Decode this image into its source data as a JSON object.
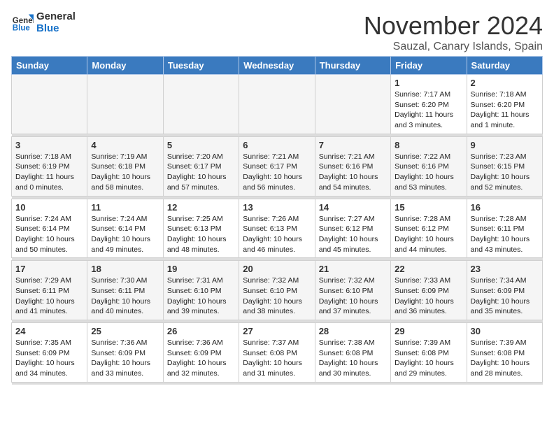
{
  "header": {
    "logo_line1": "General",
    "logo_line2": "Blue",
    "month": "November 2024",
    "location": "Sauzal, Canary Islands, Spain"
  },
  "days_of_week": [
    "Sunday",
    "Monday",
    "Tuesday",
    "Wednesday",
    "Thursday",
    "Friday",
    "Saturday"
  ],
  "weeks": [
    [
      {
        "day": "",
        "empty": true
      },
      {
        "day": "",
        "empty": true
      },
      {
        "day": "",
        "empty": true
      },
      {
        "day": "",
        "empty": true
      },
      {
        "day": "",
        "empty": true
      },
      {
        "day": "1",
        "info": "Sunrise: 7:17 AM\nSunset: 6:20 PM\nDaylight: 11 hours and 3 minutes."
      },
      {
        "day": "2",
        "info": "Sunrise: 7:18 AM\nSunset: 6:20 PM\nDaylight: 11 hours and 1 minute."
      }
    ],
    [
      {
        "day": "3",
        "info": "Sunrise: 7:18 AM\nSunset: 6:19 PM\nDaylight: 11 hours and 0 minutes."
      },
      {
        "day": "4",
        "info": "Sunrise: 7:19 AM\nSunset: 6:18 PM\nDaylight: 10 hours and 58 minutes."
      },
      {
        "day": "5",
        "info": "Sunrise: 7:20 AM\nSunset: 6:17 PM\nDaylight: 10 hours and 57 minutes."
      },
      {
        "day": "6",
        "info": "Sunrise: 7:21 AM\nSunset: 6:17 PM\nDaylight: 10 hours and 56 minutes."
      },
      {
        "day": "7",
        "info": "Sunrise: 7:21 AM\nSunset: 6:16 PM\nDaylight: 10 hours and 54 minutes."
      },
      {
        "day": "8",
        "info": "Sunrise: 7:22 AM\nSunset: 6:16 PM\nDaylight: 10 hours and 53 minutes."
      },
      {
        "day": "9",
        "info": "Sunrise: 7:23 AM\nSunset: 6:15 PM\nDaylight: 10 hours and 52 minutes."
      }
    ],
    [
      {
        "day": "10",
        "info": "Sunrise: 7:24 AM\nSunset: 6:14 PM\nDaylight: 10 hours and 50 minutes."
      },
      {
        "day": "11",
        "info": "Sunrise: 7:24 AM\nSunset: 6:14 PM\nDaylight: 10 hours and 49 minutes."
      },
      {
        "day": "12",
        "info": "Sunrise: 7:25 AM\nSunset: 6:13 PM\nDaylight: 10 hours and 48 minutes."
      },
      {
        "day": "13",
        "info": "Sunrise: 7:26 AM\nSunset: 6:13 PM\nDaylight: 10 hours and 46 minutes."
      },
      {
        "day": "14",
        "info": "Sunrise: 7:27 AM\nSunset: 6:12 PM\nDaylight: 10 hours and 45 minutes."
      },
      {
        "day": "15",
        "info": "Sunrise: 7:28 AM\nSunset: 6:12 PM\nDaylight: 10 hours and 44 minutes."
      },
      {
        "day": "16",
        "info": "Sunrise: 7:28 AM\nSunset: 6:11 PM\nDaylight: 10 hours and 43 minutes."
      }
    ],
    [
      {
        "day": "17",
        "info": "Sunrise: 7:29 AM\nSunset: 6:11 PM\nDaylight: 10 hours and 41 minutes."
      },
      {
        "day": "18",
        "info": "Sunrise: 7:30 AM\nSunset: 6:11 PM\nDaylight: 10 hours and 40 minutes."
      },
      {
        "day": "19",
        "info": "Sunrise: 7:31 AM\nSunset: 6:10 PM\nDaylight: 10 hours and 39 minutes."
      },
      {
        "day": "20",
        "info": "Sunrise: 7:32 AM\nSunset: 6:10 PM\nDaylight: 10 hours and 38 minutes."
      },
      {
        "day": "21",
        "info": "Sunrise: 7:32 AM\nSunset: 6:10 PM\nDaylight: 10 hours and 37 minutes."
      },
      {
        "day": "22",
        "info": "Sunrise: 7:33 AM\nSunset: 6:09 PM\nDaylight: 10 hours and 36 minutes."
      },
      {
        "day": "23",
        "info": "Sunrise: 7:34 AM\nSunset: 6:09 PM\nDaylight: 10 hours and 35 minutes."
      }
    ],
    [
      {
        "day": "24",
        "info": "Sunrise: 7:35 AM\nSunset: 6:09 PM\nDaylight: 10 hours and 34 minutes."
      },
      {
        "day": "25",
        "info": "Sunrise: 7:36 AM\nSunset: 6:09 PM\nDaylight: 10 hours and 33 minutes."
      },
      {
        "day": "26",
        "info": "Sunrise: 7:36 AM\nSunset: 6:09 PM\nDaylight: 10 hours and 32 minutes."
      },
      {
        "day": "27",
        "info": "Sunrise: 7:37 AM\nSunset: 6:08 PM\nDaylight: 10 hours and 31 minutes."
      },
      {
        "day": "28",
        "info": "Sunrise: 7:38 AM\nSunset: 6:08 PM\nDaylight: 10 hours and 30 minutes."
      },
      {
        "day": "29",
        "info": "Sunrise: 7:39 AM\nSunset: 6:08 PM\nDaylight: 10 hours and 29 minutes."
      },
      {
        "day": "30",
        "info": "Sunrise: 7:39 AM\nSunset: 6:08 PM\nDaylight: 10 hours and 28 minutes."
      }
    ]
  ]
}
